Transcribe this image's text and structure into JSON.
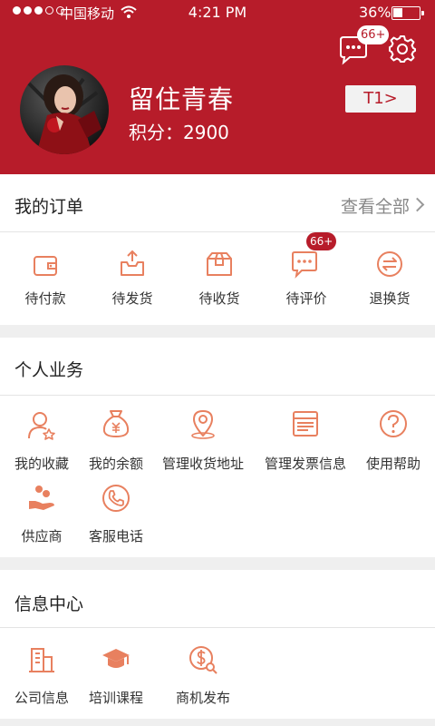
{
  "status_bar": {
    "carrier": "中国移动",
    "time": "4:21 PM",
    "battery": "36%",
    "battery_level": 0.36,
    "signal_bars_filled": 3,
    "signal_bars_total": 5
  },
  "header": {
    "message_badge": "66+",
    "username": "留住青春",
    "points": "积分：2900",
    "tier_button": "T1>"
  },
  "orders": {
    "title": "我的订单",
    "view_all": "查看全部",
    "items": [
      {
        "label": "待付款",
        "icon": "wallet-icon"
      },
      {
        "label": "待发货",
        "icon": "outbox-icon"
      },
      {
        "label": "待收货",
        "icon": "package-icon"
      },
      {
        "label": "待评价",
        "icon": "comment-icon",
        "badge": "66+"
      },
      {
        "label": "退换货",
        "icon": "exchange-icon"
      }
    ]
  },
  "personal": {
    "title": "个人业务",
    "items": [
      {
        "label": "我的收藏",
        "icon": "user-star-icon"
      },
      {
        "label": "我的余额",
        "icon": "money-bag-icon"
      },
      {
        "label": "管理收货地址",
        "icon": "location-pin-icon"
      },
      {
        "label": "管理发票信息",
        "icon": "invoice-printer-icon"
      },
      {
        "label": "使用帮助",
        "icon": "help-icon"
      },
      {
        "label": "供应商",
        "icon": "supplier-icon"
      },
      {
        "label": "客服电话",
        "icon": "phone-icon"
      }
    ]
  },
  "info_center": {
    "title": "信息中心",
    "items": [
      {
        "label": "公司信息",
        "icon": "building-icon"
      },
      {
        "label": "培训课程",
        "icon": "graduation-cap-icon"
      },
      {
        "label": "商机发布",
        "icon": "dollar-search-icon"
      }
    ]
  },
  "colors": {
    "brand_red": "#b71c2a",
    "icon_orange": "#e8805f",
    "background": "#efefef"
  }
}
